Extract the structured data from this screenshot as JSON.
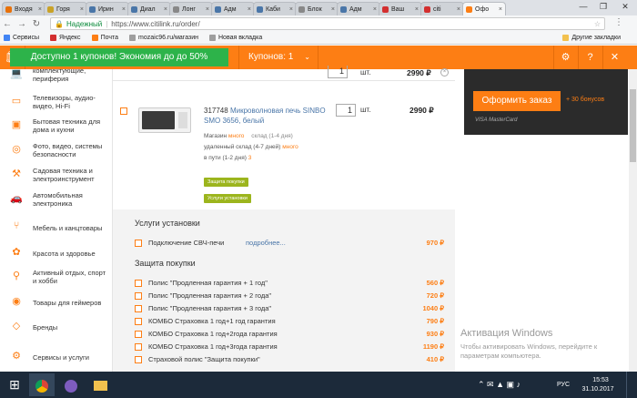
{
  "browser": {
    "tabs": [
      {
        "label": "Входя",
        "color": "#e8710a"
      },
      {
        "label": "Горя",
        "color": "#c9a227"
      },
      {
        "label": "Ирин",
        "color": "#4a76a8"
      },
      {
        "label": "Диал",
        "color": "#4a76a8"
      },
      {
        "label": "Лонг",
        "color": "#888888"
      },
      {
        "label": "Адм",
        "color": "#4a76a8"
      },
      {
        "label": "Каби",
        "color": "#4a76a8"
      },
      {
        "label": "Блок",
        "color": "#888888"
      },
      {
        "label": "Адм",
        "color": "#4a76a8"
      },
      {
        "label": "Ваш",
        "color": "#d32f2f"
      },
      {
        "label": "citi",
        "color": "#d32f2f"
      },
      {
        "label": "Офо",
        "color": "#fd7e14"
      }
    ],
    "secure_label": "Надежный",
    "url": "https://www.citilink.ru/order/",
    "bookmarks": [
      {
        "label": "Сервисы",
        "icon": "apps-icon"
      },
      {
        "label": "Яндекс",
        "icon": "yandex-icon"
      },
      {
        "label": "Почта",
        "icon": "mail-icon"
      },
      {
        "label": "mozaic96.ru/магазин",
        "icon": "page-icon"
      },
      {
        "label": "Новая вкладка",
        "icon": "page-icon"
      }
    ],
    "other_bookmarks": "Другие закладки"
  },
  "promo": {
    "coupon_text": "Доступно 1 купонов! Экономия до до 50%",
    "coupons_label": "Купонов: 1"
  },
  "sidebar": {
    "items": [
      {
        "label": "комплектующие, периферия",
        "icon": "laptop-icon"
      },
      {
        "label": "Телевизоры, аудио-видео, Hi-Fi",
        "icon": "tv-icon"
      },
      {
        "label": "Бытовая техника для дома и кухни",
        "icon": "washer-icon"
      },
      {
        "label": "Фото, видео, системы безопасности",
        "icon": "camera-icon"
      },
      {
        "label": "Садовая техника и электроинструмент",
        "icon": "drill-icon"
      },
      {
        "label": "Автомобильная электроника",
        "icon": "car-icon"
      },
      {
        "label": "Мебель и канцтовары",
        "icon": "chair-icon"
      },
      {
        "label": "Красота и здоровье",
        "icon": "beauty-icon"
      },
      {
        "label": "Активный отдых, спорт и хобби",
        "icon": "bike-icon"
      },
      {
        "label": "Товары для геймеров",
        "icon": "gamepad-icon"
      },
      {
        "label": "Бренды",
        "icon": "tag-icon"
      },
      {
        "label": "Сервисы и услуги",
        "icon": "service-icon"
      }
    ]
  },
  "cart": {
    "prev_item": {
      "qty": "1",
      "unit": "шт.",
      "price": "2990 ₽"
    },
    "item": {
      "code": "317748",
      "name": "Микроволновая печь SINBO SMO 3656, белый",
      "shop_label": "Магазин",
      "shop_status": "много",
      "store_label": "склад (1-4 дня)",
      "remote_label": "удаленный склад (4-7 дней)",
      "remote_status": "много",
      "transit_label": "в пути (1-2 дня)",
      "transit_count": "3",
      "btn_protect": "Защита покупки",
      "btn_install": "Услуги установки",
      "qty": "1",
      "unit": "шт.",
      "price": "2990 ₽"
    }
  },
  "services": {
    "install_heading": "Услуги установки",
    "install_items": [
      {
        "name": "Подключение СВЧ-печи",
        "more": "подробнее...",
        "price": "970 ₽"
      }
    ],
    "protect_heading": "Защита покупки",
    "protect_items": [
      {
        "name": "Полис \"Продленная гарантия + 1 год\"",
        "price": "560 ₽"
      },
      {
        "name": "Полис \"Продленная гарантия + 2 года\"",
        "price": "720 ₽"
      },
      {
        "name": "Полис \"Продленная гарантия + 3 года\"",
        "price": "1040 ₽"
      },
      {
        "name": "КОМБО Страховка 1 год+1 год гарантия",
        "price": "790 ₽"
      },
      {
        "name": "КОМБО Страховка 1 год+2года гарантия",
        "price": "930 ₽"
      },
      {
        "name": "КОМБО Страховка 1 год+3года гарантия",
        "price": "1190 ₽"
      },
      {
        "name": "Страховой полис \"Защита покупки\"",
        "price": "410 ₽"
      }
    ]
  },
  "order_panel": {
    "order_button": "Оформить заказ",
    "bonus": "+ 30 бонусов",
    "cards": "VISA   MasterCard"
  },
  "watermark": {
    "title": "Активация Windows",
    "line1": "Чтобы активировать Windows, перейдите к",
    "line2": "параметрам компьютера."
  },
  "taskbar": {
    "lang": "РУС",
    "time": "15:53",
    "date": "31.10.2017"
  },
  "colors": {
    "accent": "#fd7e14",
    "green": "#2db34a",
    "olive": "#9cb51d",
    "dark": "#2b2b2b"
  }
}
